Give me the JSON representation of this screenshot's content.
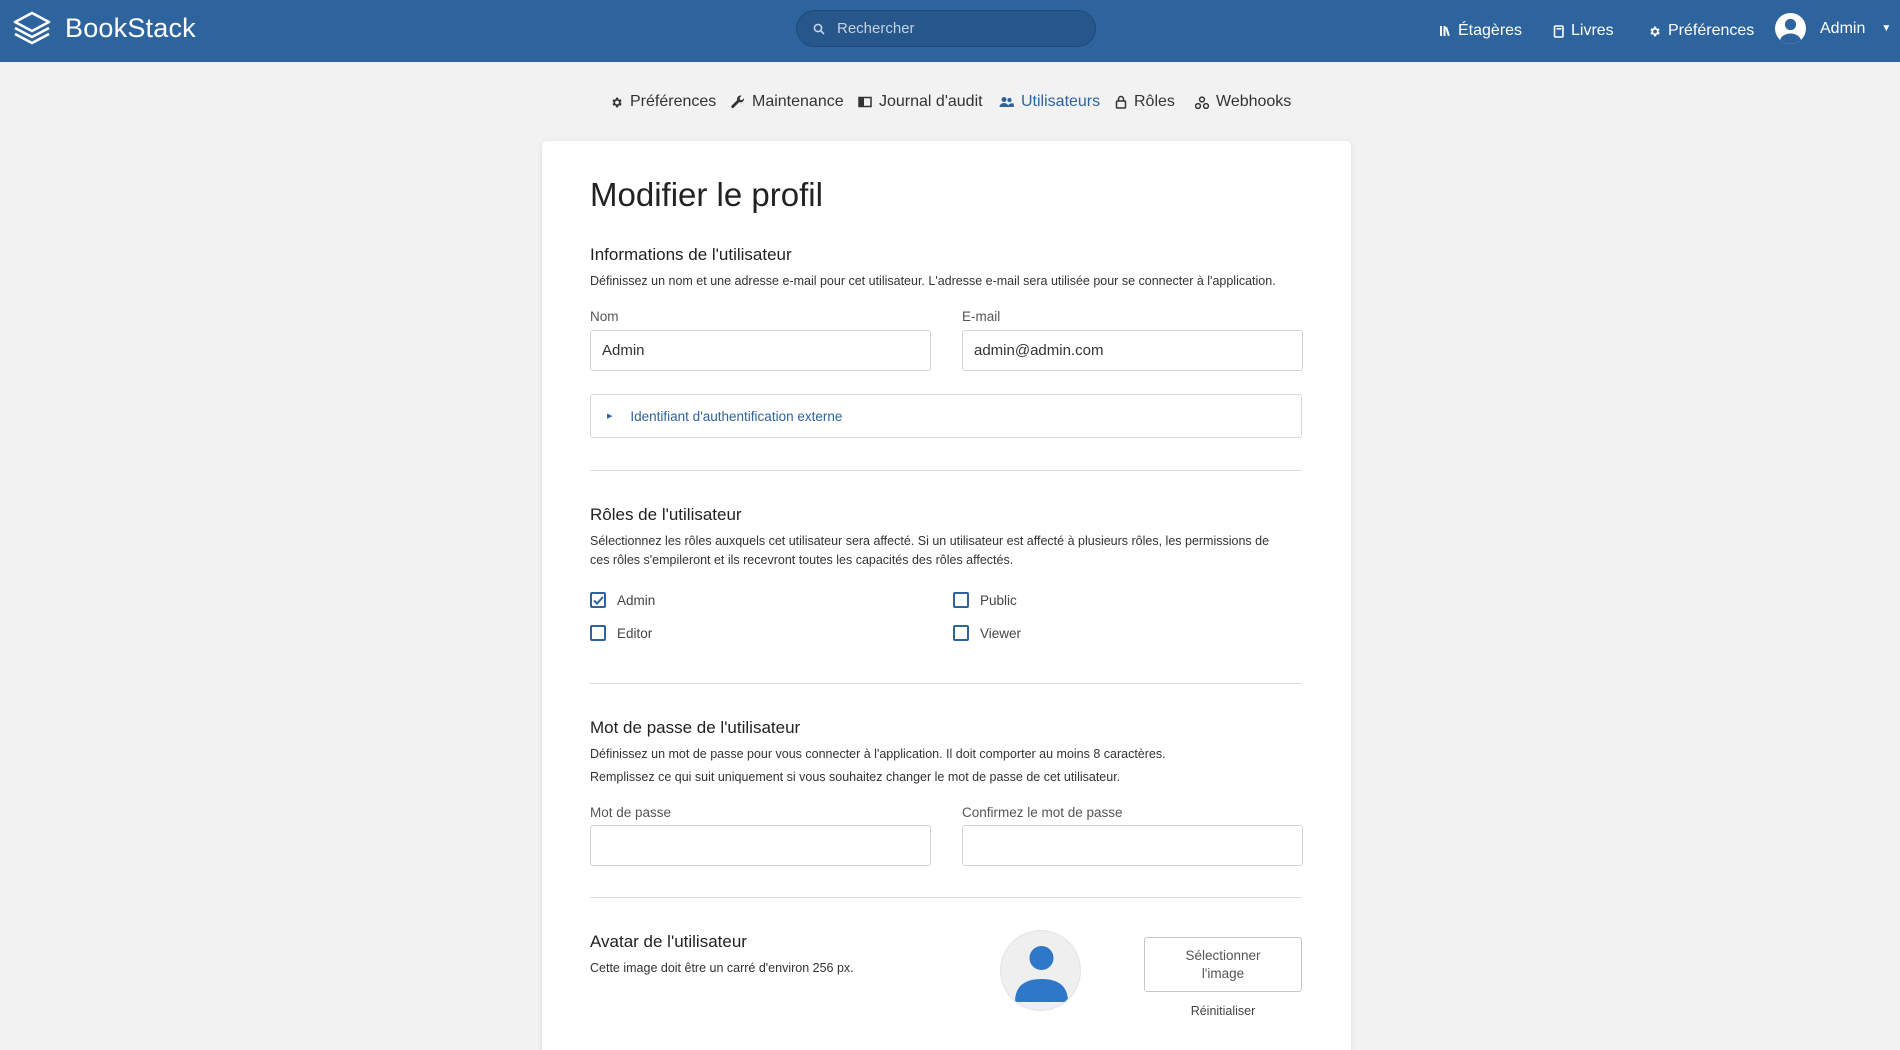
{
  "header": {
    "app_name": "BookStack",
    "search_placeholder": "Rechercher",
    "nav": [
      {
        "label": "Étagères",
        "icon": "shelves-icon"
      },
      {
        "label": "Livres",
        "icon": "books-icon"
      },
      {
        "label": "Préférences",
        "icon": "gear-icon"
      }
    ],
    "user_name": "Admin",
    "accent": "#2e649e"
  },
  "tabs": [
    {
      "label": "Préférences",
      "icon": "gear-icon",
      "active": false
    },
    {
      "label": "Maintenance",
      "icon": "wrench-icon",
      "active": false
    },
    {
      "label": "Journal d'audit",
      "icon": "audit-log-icon",
      "active": false
    },
    {
      "label": "Utilisateurs",
      "icon": "users-icon",
      "active": true
    },
    {
      "label": "Rôles",
      "icon": "lock-icon",
      "active": false
    },
    {
      "label": "Webhooks",
      "icon": "webhooks-icon",
      "active": false
    }
  ],
  "form": {
    "title": "Modifier le profil",
    "info": {
      "title": "Informations de l'utilisateur",
      "desc": "Définissez un nom et une adresse e-mail pour cet utilisateur. L'adresse e-mail sera utilisée pour se connecter à l'application.",
      "name_label": "Nom",
      "name_value": "Admin",
      "email_label": "E-mail",
      "email_value": "admin@admin.com",
      "external_auth_label": "Identifiant d'authentification externe"
    },
    "roles": {
      "title": "Rôles de l'utilisateur",
      "desc_line1": "Sélectionnez les rôles auxquels cet utilisateur sera affecté. Si un utilisateur est affecté à plusieurs rôles, les permissions de",
      "desc_line2": "ces rôles s'empileront et ils recevront toutes les capacités des rôles affectés.",
      "items": [
        {
          "label": "Admin",
          "checked": true
        },
        {
          "label": "Public",
          "checked": false
        },
        {
          "label": "Editor",
          "checked": false
        },
        {
          "label": "Viewer",
          "checked": false
        }
      ]
    },
    "password": {
      "title": "Mot de passe de l'utilisateur",
      "desc_line1": "Définissez un mot de passe pour vous connecter à l'application. Il doit comporter au moins 8 caractères.",
      "desc_line2": "Remplissez ce qui suit uniquement si vous souhaitez changer le mot de passe de cet utilisateur.",
      "password_label": "Mot de passe",
      "password_value": "",
      "confirm_label": "Confirmez le mot de passe",
      "confirm_value": ""
    },
    "avatar": {
      "title": "Avatar de l'utilisateur",
      "desc": "Cette image doit être un carré d'environ 256 px.",
      "select_label_line1": "Sélectionner",
      "select_label_line2": "l'image",
      "reset_label": "Réinitialiser"
    }
  }
}
